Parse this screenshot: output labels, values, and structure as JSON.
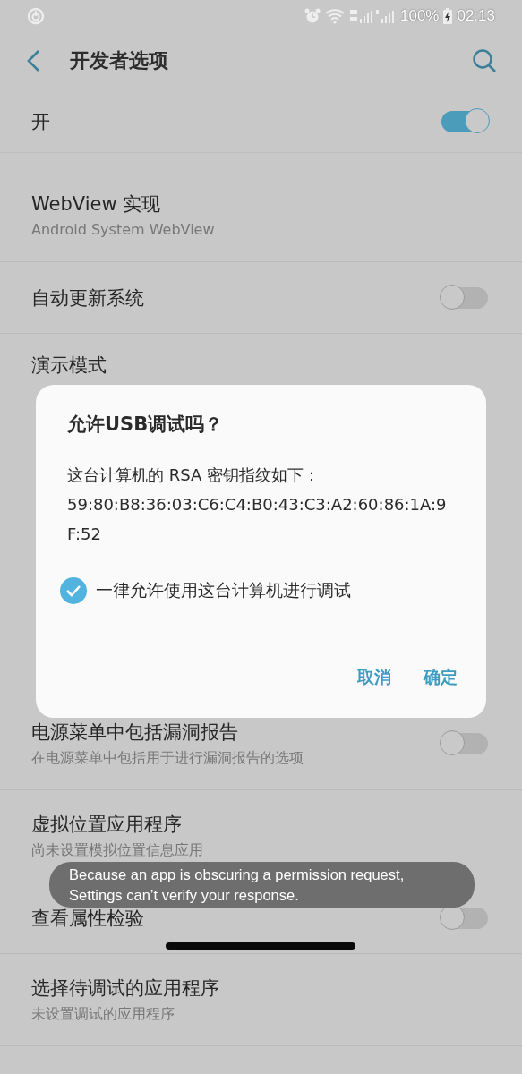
{
  "status_bar": {
    "battery": "100%",
    "time": "02:13"
  },
  "header": {
    "title": "开发者选项"
  },
  "master": {
    "label": "开",
    "on": true
  },
  "settings": [
    {
      "kind": "detail",
      "title": "WebView 实现",
      "subtitle": "Android System WebView"
    },
    {
      "kind": "switch",
      "title": "自动更新系统",
      "on": false
    },
    {
      "kind": "plain",
      "title": "演示模式"
    },
    {
      "kind": "switch",
      "title": "电源菜单中包括漏洞报告",
      "subtitle": "在电源菜单中包括用于进行漏洞报告的选项",
      "on": false
    },
    {
      "kind": "detail",
      "title": "虚拟位置应用程序",
      "subtitle": "尚未设置模拟位置信息应用"
    },
    {
      "kind": "switch",
      "title": "查看属性检验",
      "on": false
    },
    {
      "kind": "detail",
      "title": "选择待调试的应用程序",
      "subtitle": "未设置调试的应用程序"
    }
  ],
  "dialog": {
    "title": "允许USB调试吗？",
    "message": "这台计算机的 RSA 密钥指纹如下：",
    "fingerprint": "59:80:B8:36:03:C6:C4:B0:43:C3:A2:60:86:1A:9F:52",
    "checkbox": {
      "label": "一律允许使用这台计算机进行调试",
      "checked": true
    },
    "buttons": [
      "取消",
      "确定"
    ]
  },
  "toast": {
    "text": "Because an app is obscuring a permission request, Settings can’t verify your response."
  }
}
